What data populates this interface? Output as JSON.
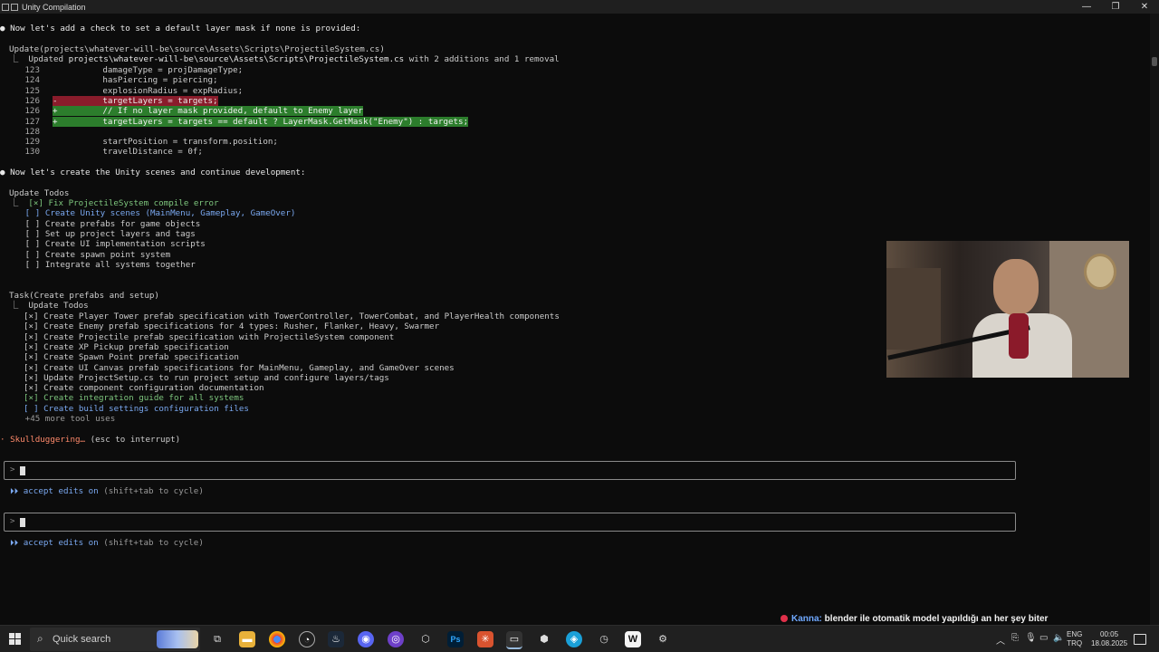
{
  "window": {
    "title": "Unity Compilation",
    "controls": {
      "minimize": "—",
      "maximize": "❐",
      "close": "✕"
    }
  },
  "terminal": {
    "l1": "● Now let's add a check to set a default layer mask if none is provided:",
    "l2": "Update(projects\\whatever-will-be\\source\\Assets\\Scripts\\ProjectileSystem.cs)",
    "l3a": "  ⎿  Updated ",
    "l3b": "projects\\whatever-will-be\\source\\Assets\\Scripts\\ProjectileSystem.cs",
    "l3c": " with 2 additions and 1 removal",
    "code": [
      {
        "num": "123",
        "sign": " ",
        "text": "         damageType = projDamageType;",
        "style": ""
      },
      {
        "num": "124",
        "sign": " ",
        "text": "         hasPiercing = piercing;",
        "style": ""
      },
      {
        "num": "125",
        "sign": " ",
        "text": "         explosionRadius = expRadius;",
        "style": ""
      },
      {
        "num": "126",
        "sign": "-",
        "text": "         targetLayers = targets;",
        "style": "red"
      },
      {
        "num": "126",
        "sign": "+",
        "text": "         // If no layer mask provided, default to Enemy layer",
        "style": "green"
      },
      {
        "num": "127",
        "sign": "+",
        "text": "         targetLayers = targets == default ? LayerMask.GetMask(\"Enemy\") : targets;",
        "style": "green"
      },
      {
        "num": "128",
        "sign": " ",
        "text": "",
        "style": ""
      },
      {
        "num": "129",
        "sign": " ",
        "text": "         startPosition = transform.position;",
        "style": ""
      },
      {
        "num": "130",
        "sign": " ",
        "text": "         travelDistance = 0f;",
        "style": ""
      }
    ],
    "l4": "● Now let's create the Unity scenes and continue development:",
    "l5": "Update Todos",
    "todos1": [
      {
        "prefix": "  ⎿  ",
        "box": "[×]",
        "text": " Fix ProjectileSystem compile error",
        "cls": "green"
      },
      {
        "prefix": "     ",
        "box": "[ ]",
        "text": " Create Unity scenes (MainMenu, Gameplay, GameOver)",
        "cls": "blue"
      },
      {
        "prefix": "     ",
        "box": "[ ]",
        "text": " Create prefabs for game objects",
        "cls": ""
      },
      {
        "prefix": "     ",
        "box": "[ ]",
        "text": " Set up project layers and tags",
        "cls": ""
      },
      {
        "prefix": "     ",
        "box": "[ ]",
        "text": " Create UI implementation scripts",
        "cls": ""
      },
      {
        "prefix": "     ",
        "box": "[ ]",
        "text": " Create spawn point system",
        "cls": ""
      },
      {
        "prefix": "     ",
        "box": "[ ]",
        "text": " Integrate all systems together",
        "cls": ""
      }
    ],
    "l6": "Task(Create prefabs and setup)",
    "l7": "  ⎿  Update Todos",
    "todos2": [
      {
        "box": "[×]",
        "text": " Create Player Tower prefab specification with TowerController, TowerCombat, and PlayerHealth components",
        "cls": ""
      },
      {
        "box": "[×]",
        "text": " Create Enemy prefab specifications for 4 types: Rusher, Flanker, Heavy, Swarmer",
        "cls": ""
      },
      {
        "box": "[×]",
        "text": " Create Projectile prefab specification with ProjectileSystem component",
        "cls": ""
      },
      {
        "box": "[×]",
        "text": " Create XP Pickup prefab specification",
        "cls": ""
      },
      {
        "box": "[×]",
        "text": " Create Spawn Point prefab specification",
        "cls": ""
      },
      {
        "box": "[×]",
        "text": " Create UI Canvas prefab specifications for MainMenu, Gameplay, and GameOver scenes",
        "cls": ""
      },
      {
        "box": "[×]",
        "text": " Update ProjectSetup.cs to run project setup and configure layers/tags",
        "cls": ""
      },
      {
        "box": "[×]",
        "text": " Create component configuration documentation",
        "cls": ""
      },
      {
        "box": "[×]",
        "text": " Create integration guide for all systems",
        "cls": "green"
      },
      {
        "box": "[ ]",
        "text": " Create build settings configuration files",
        "cls": "blue"
      }
    ],
    "more": "     +45 more tool uses",
    "status_star": "·",
    "status_word": " Skullduggering…",
    "status_hint": " (esc to interrupt)",
    "prompt_symbol": ">",
    "mode1_icon": "⏵⏵",
    "mode1_a": " accept edits on",
    "mode1_b": " (shift+tab to cycle)"
  },
  "chat": {
    "user": "Kanna:",
    "message": " blender ile otomatik model yapıldığı an her şey biter"
  },
  "taskbar": {
    "search_label": "Quick search",
    "lang_top": "ENG",
    "lang_bottom": "TRQ",
    "time": "00:05",
    "date": "18.08.2025"
  }
}
